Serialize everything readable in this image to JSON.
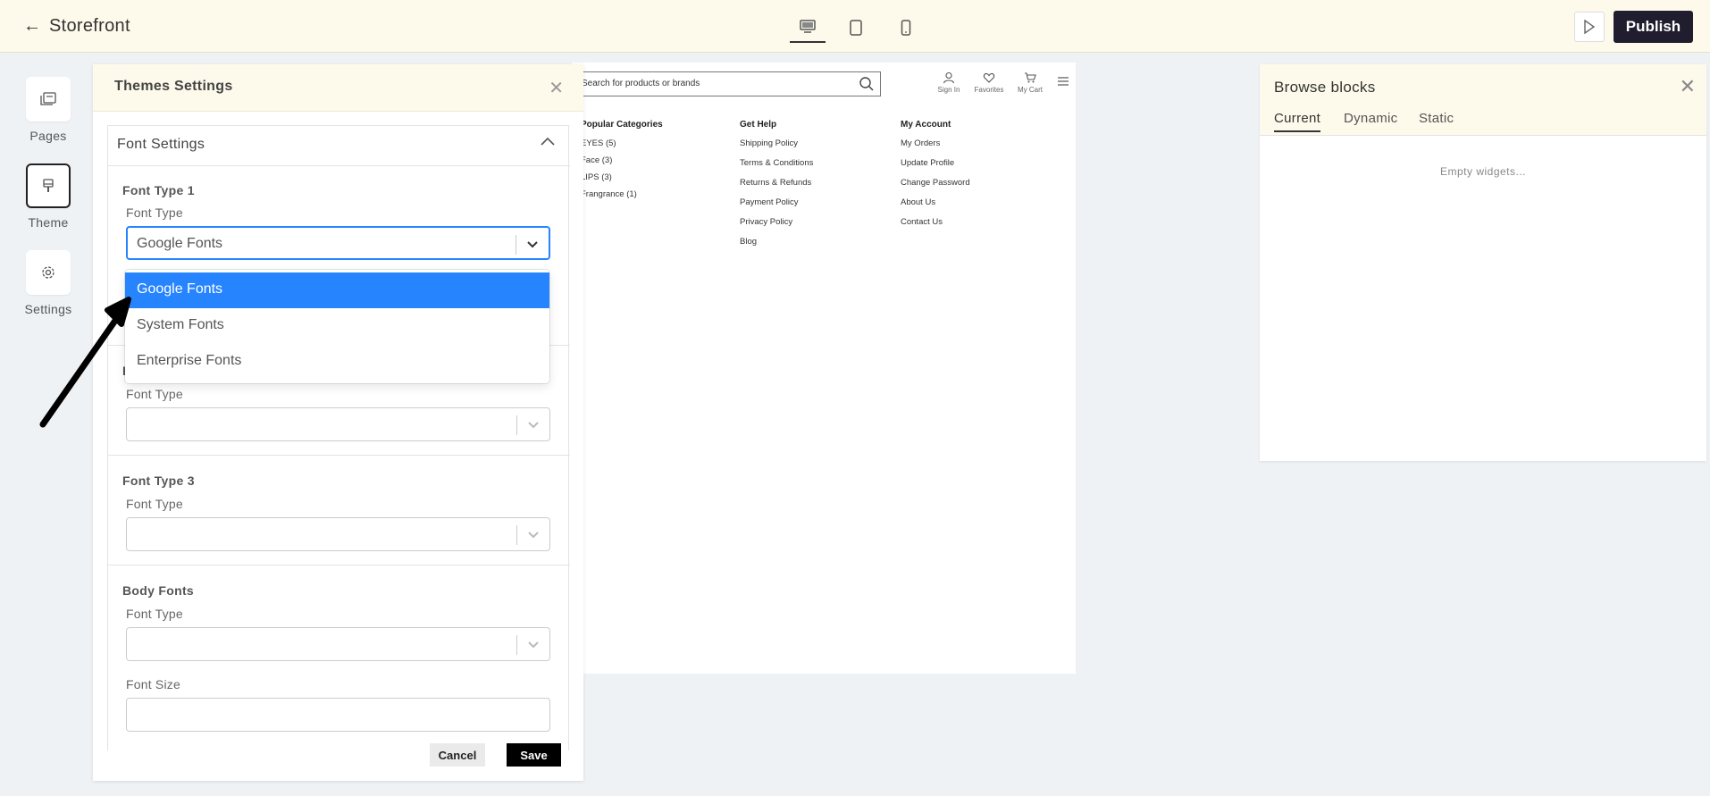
{
  "topbar": {
    "title": "Storefront",
    "publish_label": "Publish"
  },
  "rail": {
    "items": [
      {
        "label": "Pages"
      },
      {
        "label": "Theme"
      },
      {
        "label": "Settings"
      }
    ]
  },
  "preview": {
    "search_placeholder": "Search for products or brands",
    "header_icons": [
      {
        "label": "Sign In"
      },
      {
        "label": "Favorites"
      },
      {
        "label": "My Cart"
      }
    ],
    "footer": {
      "col1": {
        "title": "Popular Categories",
        "items": [
          "EYES (5)",
          "Face (3)",
          "LIPS (3)",
          "Frangrance (1)"
        ]
      },
      "col2": {
        "title": "Get Help",
        "items": [
          "Shipping Policy",
          "Terms & Conditions",
          "Returns & Refunds",
          "Payment Policy",
          "Privacy Policy",
          "Blog"
        ]
      },
      "col3": {
        "title": "My Account",
        "items": [
          "My Orders",
          "Update Profile",
          "Change Password",
          "About Us",
          "Contact Us"
        ]
      }
    }
  },
  "themes": {
    "title": "Themes Settings",
    "font_settings_title": "Font Settings",
    "sections": {
      "font1": {
        "title": "Font Type 1",
        "field": "Font Type",
        "value": "Google Fonts"
      },
      "font2": {
        "field": "Font Type"
      },
      "font3": {
        "title": "Font Type 3",
        "field": "Font Type"
      },
      "body": {
        "title": "Body Fonts",
        "field": "Font Type",
        "size_label": "Font Size"
      }
    },
    "dropdown_options": [
      "Google Fonts",
      "System Fonts",
      "Enterprise Fonts"
    ],
    "selected_option": "Google Fonts",
    "cancel_label": "Cancel",
    "save_label": "Save"
  },
  "browse": {
    "title": "Browse blocks",
    "tabs": [
      "Current",
      "Dynamic",
      "Static"
    ],
    "active_tab": "Current",
    "empty_text": "Empty widgets..."
  },
  "colors": {
    "topbar_bg": "#fdfaeb",
    "publish_bg": "#1f1d2e",
    "select_focus": "#2684ff",
    "option_selected": "#2684ff"
  }
}
